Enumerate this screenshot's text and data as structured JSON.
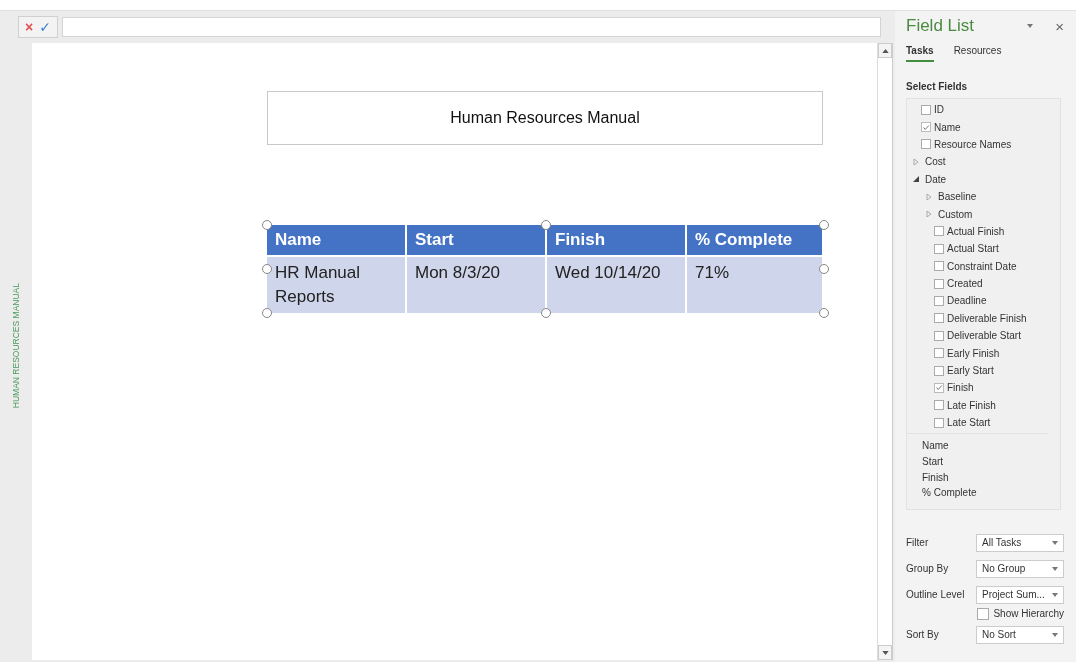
{
  "formula_bar": {
    "cancel": "×",
    "confirm": "✓"
  },
  "side_label": "HUMAN RESOURCES MANUAL",
  "report": {
    "title": "Human Resources Manual",
    "table": {
      "columns": [
        "Name",
        "Start",
        "Finish",
        "% Complete"
      ],
      "rows": [
        [
          "HR Manual Reports",
          "Mon 8/3/20",
          "Wed 10/14/20",
          "71%"
        ]
      ]
    }
  },
  "field_list": {
    "title": "Field List",
    "close": "×",
    "tabs": [
      {
        "label": "Tasks",
        "selected": true
      },
      {
        "label": "Resources",
        "selected": false
      }
    ],
    "select_label": "Select Fields",
    "fields": [
      {
        "kind": "checkbox",
        "label": "ID",
        "checked": false
      },
      {
        "kind": "checkbox",
        "label": "Name",
        "checked": true
      },
      {
        "kind": "checkbox",
        "label": "Resource Names",
        "checked": false
      },
      {
        "kind": "group",
        "label": "Cost",
        "expanded": false
      },
      {
        "kind": "group",
        "label": "Date",
        "expanded": true,
        "children": [
          {
            "kind": "group",
            "label": "Baseline",
            "expanded": false
          },
          {
            "kind": "group",
            "label": "Custom",
            "expanded": false
          },
          {
            "kind": "checkbox",
            "label": "Actual Finish",
            "checked": false
          },
          {
            "kind": "checkbox",
            "label": "Actual Start",
            "checked": false
          },
          {
            "kind": "checkbox",
            "label": "Constraint Date",
            "checked": false
          },
          {
            "kind": "checkbox",
            "label": "Created",
            "checked": false
          },
          {
            "kind": "checkbox",
            "label": "Deadline",
            "checked": false
          },
          {
            "kind": "checkbox",
            "label": "Deliverable Finish",
            "checked": false
          },
          {
            "kind": "checkbox",
            "label": "Deliverable Start",
            "checked": false
          },
          {
            "kind": "checkbox",
            "label": "Early Finish",
            "checked": false
          },
          {
            "kind": "checkbox",
            "label": "Early Start",
            "checked": false
          },
          {
            "kind": "checkbox",
            "label": "Finish",
            "checked": true
          },
          {
            "kind": "checkbox",
            "label": "Late Finish",
            "checked": false
          },
          {
            "kind": "checkbox",
            "label": "Late Start",
            "checked": false
          }
        ]
      }
    ],
    "selected_fields": [
      "Name",
      "Start",
      "Finish",
      "% Complete"
    ],
    "options": [
      {
        "kind": "dropdown",
        "label": "Filter",
        "value": "All Tasks"
      },
      {
        "kind": "dropdown",
        "label": "Group By",
        "value": "No Group"
      },
      {
        "kind": "dropdown",
        "label": "Outline Level",
        "value": "Project Sum..."
      },
      {
        "kind": "checkbox",
        "label": "Show Hierarchy",
        "checked": false
      },
      {
        "kind": "dropdown",
        "label": "Sort By",
        "value": "No Sort"
      }
    ]
  }
}
